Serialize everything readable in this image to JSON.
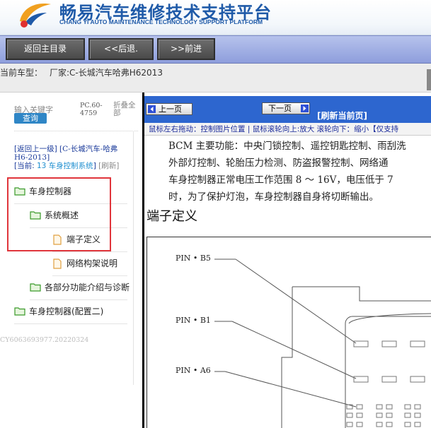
{
  "header": {
    "title": "畅易汽车维修技术支持平台",
    "subtitle": "CHANG YI AUTO MAINTENANCE TECHNOLOGY SUPPORT PLATFORM"
  },
  "nav": {
    "home": "返回主目录",
    "back": "<<后退.",
    "forward": ">>前进"
  },
  "vehicle": {
    "label": "当前车型：",
    "value": "厂家:C-长城汽车哈弗H62013"
  },
  "sidebar": {
    "keyword_label": "输入关键字",
    "query_button": "查询",
    "pc_version": "PC.60-4759",
    "collapse_all": "折叠全部",
    "breadcrumb": {
      "back_up": "[返回上一级]",
      "make": "[C-长城汽车-哈弗H6-2013]",
      "current_prefix": "[当前:",
      "current": " 13 车身控制系统",
      "current_suffix": "]",
      "refresh": "[刷新]"
    },
    "tree": [
      {
        "label": "车身控制器",
        "type": "folder"
      },
      {
        "label": "系统概述",
        "type": "folder"
      },
      {
        "label": "端子定义",
        "type": "document"
      },
      {
        "label": "网络构架说明",
        "type": "document"
      },
      {
        "label": "各部分功能介绍与诊断",
        "type": "folder"
      },
      {
        "label": "车身控制器(配置二)",
        "type": "folder"
      }
    ],
    "watermark": "CY6063693977.20220324"
  },
  "content": {
    "prev_page": "上一页",
    "next_page": "下一页",
    "refresh_page": "[刷新当前页]",
    "hint": "鼠标左右拖动：控制图片位置 | 鼠标滚轮向上:放大  滚轮向下：缩小【仅支持"
  },
  "document": {
    "lines": [
      "BCM 主要功能：中央门锁控制、遥控钥匙控制、雨刮洗",
      "外部灯控制、轮胎压力检测、防盗报警控制、网络通",
      "车身控制器正常电压工作范围 8 ～ 16V，电压低于 7",
      "时，为了保护灯泡，车身控制器自身将切断输出。"
    ],
    "section_title": "端子定义",
    "pins": [
      "PIN • B5",
      "PIN • B1",
      "PIN • A6"
    ]
  },
  "colors": {
    "brand_blue": "#1f5aa8",
    "nav_bar": "#9aa8e2",
    "toolbar_blue": "#2d66cf",
    "highlight_red": "#e0353b",
    "folder_green": "#3a9a2a",
    "document_orange": "#e0a040"
  }
}
